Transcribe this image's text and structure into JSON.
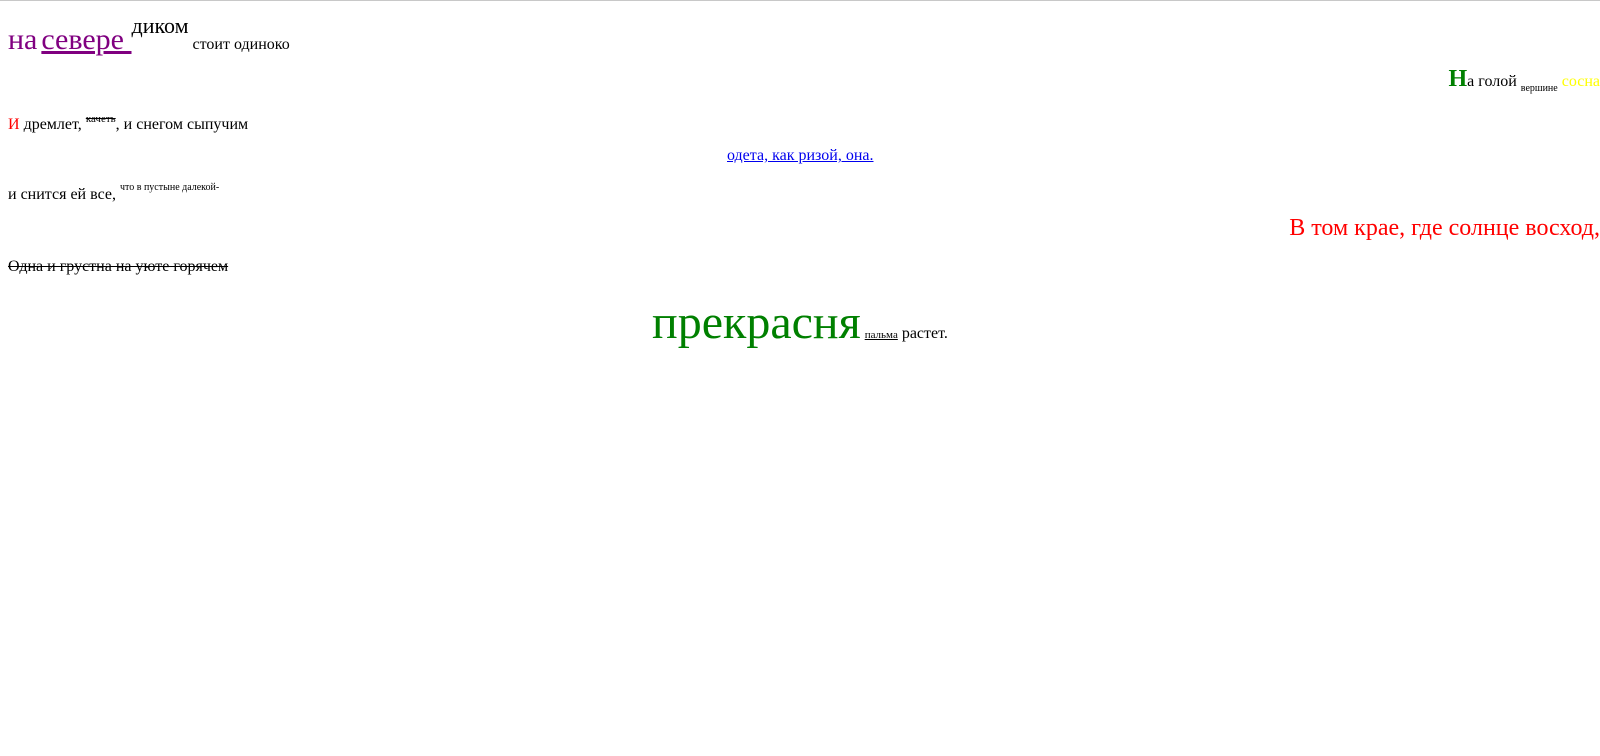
{
  "poem": {
    "line1": {
      "word1": "на",
      "link": "севере ",
      "sup": "диком",
      "rest": " стоит одиноко"
    },
    "line2": {
      "first_letter": "Н",
      "text": "а голой ",
      "sub": "вершине",
      "last": " сосна"
    },
    "line3": {
      "first_letter": "И",
      "text1": " дремлет, ",
      "strike_sup": "качеть",
      "text2": ", и снегом сыпучим"
    },
    "line4": {
      "link": "одета, как ризой, она."
    },
    "line5": {
      "text": "и снится ей все, ",
      "sup": "что в пустыне далекой-"
    },
    "line6": {
      "text": "В том крае, где солнце восход,"
    },
    "line7": {
      "text": "Одна и грустна на уюте горячем"
    },
    "line8": {
      "big": "прекрасня",
      "small": "пальма",
      "rest": " растет."
    }
  },
  "colors": {
    "purple": "#800080",
    "green": "#008000",
    "yellow": "#ffff00",
    "red": "#ff0000",
    "link_blue": "#0000ee"
  }
}
